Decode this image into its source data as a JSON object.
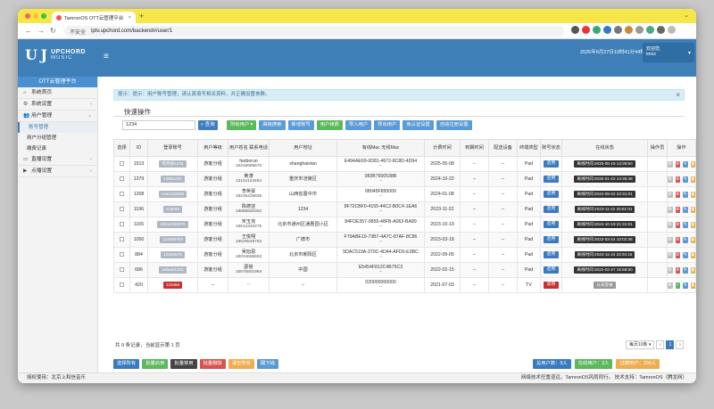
{
  "browser": {
    "tab_title": "TamronOS OTT云管理平台",
    "secure_label": "不安全",
    "url": "iptv.upchord.com/backend#/user/1"
  },
  "header": {
    "brand_line1": "UPCHORD",
    "brand_line2": "MUSIC",
    "datetime": "2025年5月27日10时41分44秒",
    "user_greeting": "欢迎您,",
    "user_name": "tmos"
  },
  "sidebar": {
    "title": "OTT云管理平台",
    "items": [
      {
        "label": "系统首页"
      },
      {
        "label": "系统设置"
      },
      {
        "label": "用户管理"
      }
    ],
    "subitems": [
      {
        "label": "账号管理"
      },
      {
        "label": "用户分组管理"
      },
      {
        "label": "缴费记录"
      }
    ],
    "items2": [
      {
        "label": "直播设置"
      },
      {
        "label": "点播设置"
      }
    ]
  },
  "notice": {
    "text": "提示：提示：用户账号管理，请认真填写相关资料，并正确设置参数。"
  },
  "quick": {
    "title": "快速操作",
    "search_value": "1234",
    "search_button": "查询",
    "buttons": [
      "所有用户 ▾",
      "高级搜索",
      "新增账号",
      "用户续费",
      "导入用户",
      "导出用户",
      "免认证设置",
      "自动注册设置"
    ]
  },
  "table": {
    "headers": [
      "选择",
      "ID",
      "登录账号",
      "用户等级",
      "用户姓名 联系电话",
      "用户地址",
      "有线Mac 无线Mac",
      "计费时间",
      "到期时间",
      "配送设备",
      "终端类型",
      "账号状态",
      "在线状态",
      "操作员",
      "操作"
    ],
    "rows": [
      {
        "id": "1513",
        "account": "有件组1234",
        "level": "游客分组",
        "name": "fanboruo",
        "phone": "15316685570",
        "addr": "shanghaixian",
        "mac1": "E494AE69-0D81-4672-8C8D-4D94",
        "mac2": "--",
        "time": "2025-05-08",
        "exp": "--",
        "dev": "--",
        "term": "Pad",
        "status": "启用",
        "online": "离线时间:2025-05-19 13:36:50"
      },
      {
        "id": "1379",
        "account": "12551234",
        "level": "游客分组",
        "name": "黄涛",
        "phone": "13101123494",
        "addr": "重庆市涪陵区",
        "mac1": "083B7600538B",
        "mac2": "--",
        "time": "2024-10-22",
        "exp": "--",
        "dev": "--",
        "term": "Pad",
        "status": "启用",
        "online": "离线时间:2025-01-22 14:35:48"
      },
      {
        "id": "1208",
        "account": "Lean123456",
        "level": "游客分组",
        "name": "李英豪",
        "phone": "18235425835",
        "addr": "山西省晋中市",
        "mac1": "08045F895000",
        "mac2": "--",
        "time": "2024-01-08",
        "exp": "--",
        "dev": "--",
        "term": "Pad",
        "status": "启用",
        "online": "离线时间:2024-09-22 22:31:01"
      },
      {
        "id": "1196",
        "account": "Kate99",
        "level": "游客分组",
        "name": "陈德亚",
        "phone": "18888926352",
        "addr": "1234",
        "mac1": "8F72CBF0-4155-44C2-B0C4-1EA6",
        "mac2": "--",
        "time": "2023-11-22",
        "exp": "--",
        "dev": "--",
        "term": "Pad",
        "status": "启用",
        "online": "离线时间:2023-11-22 20:51:01"
      },
      {
        "id": "1165",
        "account": "18612340275",
        "level": "游客分组",
        "name": "宋玉克",
        "phone": "18612340275",
        "addr": "北京市通州区通惠园小区",
        "mac1": "84FDE357-0855-48FB-A063-BA89",
        "mac2": "--",
        "time": "2023-10-19",
        "exp": "--",
        "dev": "--",
        "term": "Pad",
        "status": "启用",
        "online": "离线时间:2024-10-19 21:31:01"
      },
      {
        "id": "1050",
        "account": "123456783",
        "level": "游客分组",
        "name": "王俊翔",
        "phone": "18529549763",
        "addr": "广德市",
        "mac1": "F79ABE10-73B7-4A7C-87AF-8C86",
        "mac2": "--",
        "time": "2023-03-18",
        "exp": "--",
        "dev": "--",
        "term": "Pad",
        "status": "启用",
        "online": "离线时间:2023-03-24 10:02:36"
      },
      {
        "id": "884",
        "account": "12345678",
        "level": "游客分组",
        "name": "吴旭恩",
        "phone": "18034655553",
        "addr": "北京市朝阳区",
        "mac1": "5DAC519A-370C-4D44-AFD0-E3BC",
        "mac2": "--",
        "time": "2022-09-05",
        "exp": "--",
        "dev": "--",
        "term": "Pad",
        "status": "启用",
        "online": "离线时间:2022-11-24 23:34:15"
      },
      {
        "id": "686",
        "account": "anliwei1234",
        "level": "游客分组",
        "name": "邵俊",
        "phone": "16675801984",
        "addr": "中国",
        "mac1": "E5454F812C4B75C3",
        "mac2": "--",
        "time": "2022-02-15",
        "exp": "--",
        "dev": "--",
        "term": "Pad",
        "status": "启用",
        "online": "离线时间:2022-02-27 15:58:50"
      },
      {
        "id": "420",
        "account": "123456",
        "level": "--",
        "name": "",
        "phone": "--",
        "addr": "--",
        "mac1": "020000000000",
        "mac2": "--",
        "time": "2021-07-03",
        "exp": "--",
        "dev": "--",
        "term": "TV",
        "status": "禁用",
        "online": "从未登录"
      }
    ]
  },
  "summary": "共 9 条记录，当前显示第 1 页",
  "pager": {
    "size": "每页10条 ▾",
    "prev": "‹",
    "current": "1",
    "next": "›"
  },
  "bottom_buttons": [
    "选择所有",
    "批量启用",
    "批量禁用",
    "批量删除",
    "清空所有",
    "踢下线"
  ],
  "counts": [
    "总用户数：9人",
    "在线用户：3人",
    "过期用户：336人"
  ],
  "statusbar": {
    "left": "授权使用：北京上和信音乐",
    "right": "网络技术任重道远，TamronOS风雨同行。 技术支持：TamronOS（腾龙网）"
  }
}
